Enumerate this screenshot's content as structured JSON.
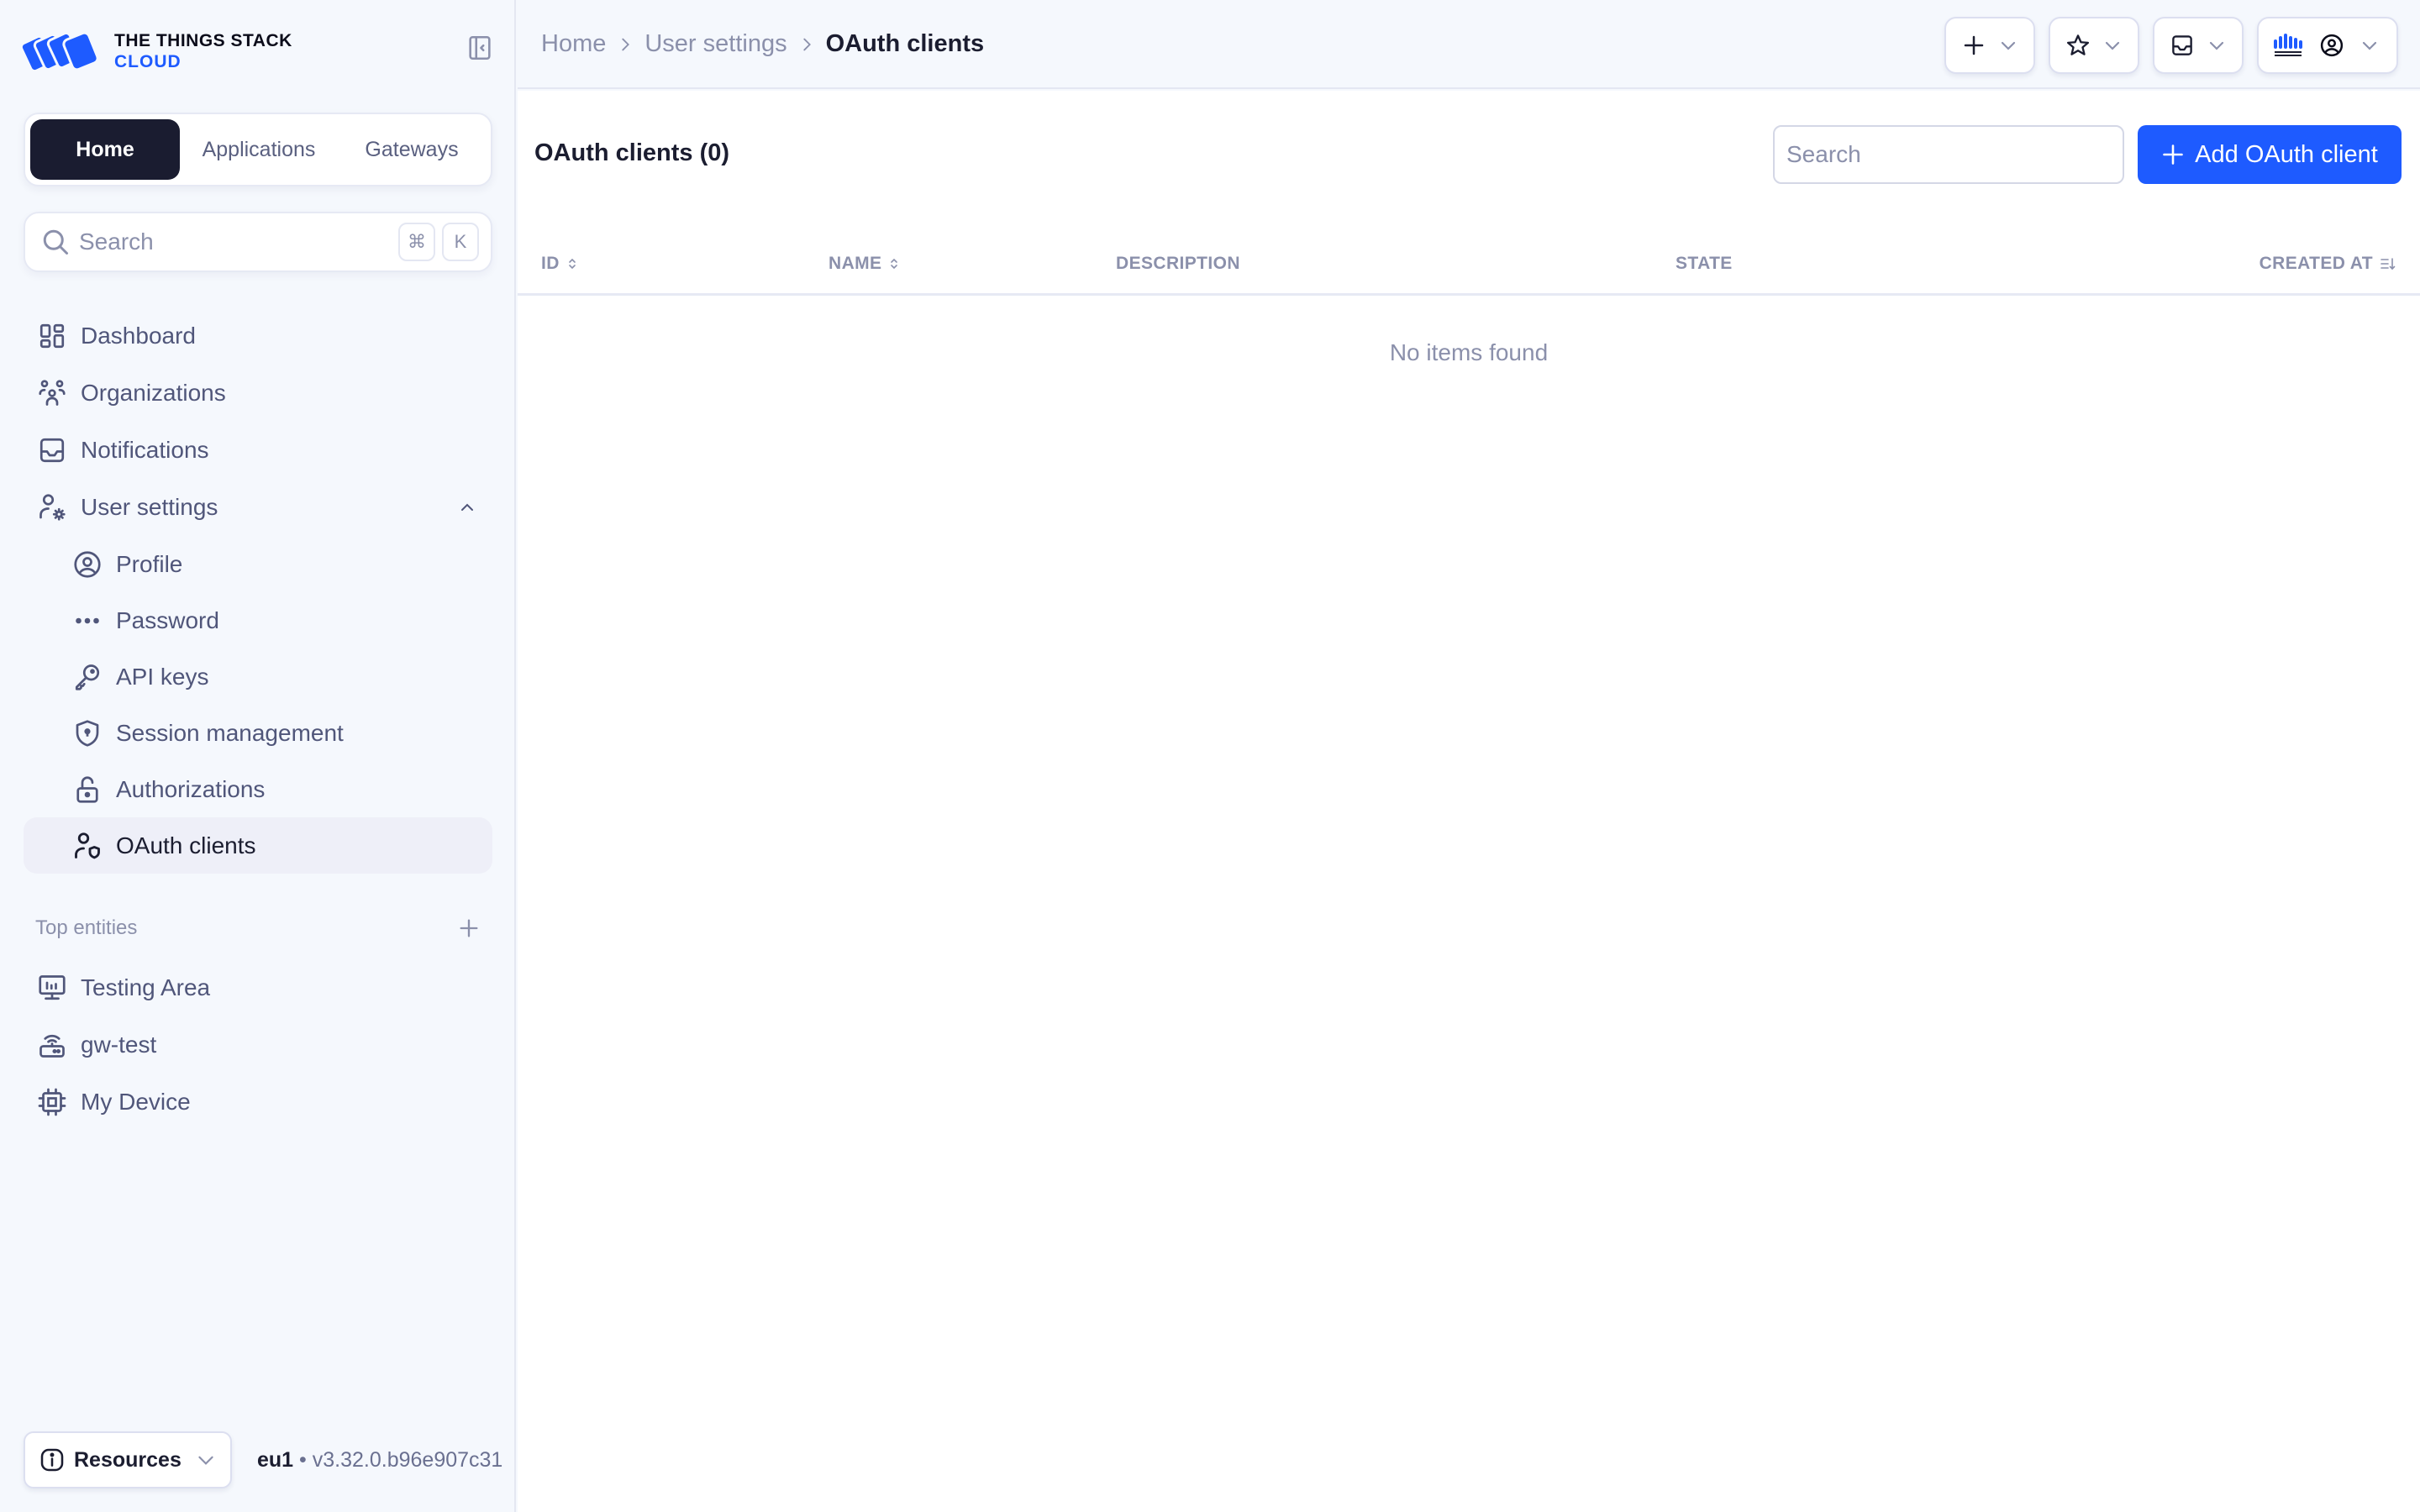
{
  "brand": {
    "line1": "THE THINGS STACK",
    "line2": "CLOUD",
    "accent_color": "#1e5bff",
    "logo_icon": "stacked-cards-logo"
  },
  "sidebar": {
    "collapse_icon": "sidebar-collapse-icon",
    "switcher": [
      {
        "label": "Home",
        "active": true
      },
      {
        "label": "Applications",
        "active": false
      },
      {
        "label": "Gateways",
        "active": false
      }
    ],
    "search": {
      "placeholder": "Search",
      "shortcut_mod": "⌘",
      "shortcut_key": "K"
    },
    "nav": [
      {
        "label": "Dashboard",
        "icon": "dashboard-icon"
      },
      {
        "label": "Organizations",
        "icon": "organizations-icon"
      },
      {
        "label": "Notifications",
        "icon": "inbox-icon"
      },
      {
        "label": "User settings",
        "icon": "user-settings-icon",
        "expanded": true,
        "children": [
          {
            "label": "Profile",
            "icon": "profile-icon"
          },
          {
            "label": "Password",
            "icon": "password-icon"
          },
          {
            "label": "API keys",
            "icon": "key-icon"
          },
          {
            "label": "Session management",
            "icon": "shield-lock-icon"
          },
          {
            "label": "Authorizations",
            "icon": "unlock-icon"
          },
          {
            "label": "OAuth clients",
            "icon": "user-shield-icon",
            "active": true
          }
        ]
      }
    ],
    "top_entities": {
      "title": "Top entities",
      "items": [
        {
          "label": "Testing Area",
          "icon": "application-icon"
        },
        {
          "label": "gw-test",
          "icon": "gateway-icon"
        },
        {
          "label": "My Device",
          "icon": "device-chip-icon"
        }
      ]
    },
    "footer": {
      "resources_label": "Resources",
      "cluster": "eu1",
      "separator": " • ",
      "version": "v3.32.0.b96e907c31"
    }
  },
  "header": {
    "breadcrumb": [
      {
        "label": "Home"
      },
      {
        "label": "User settings"
      },
      {
        "label": "OAuth clients",
        "current": true
      }
    ],
    "actions": [
      {
        "name": "add-menu",
        "icon": "plus-icon"
      },
      {
        "name": "bookmarks-menu",
        "icon": "star-icon"
      },
      {
        "name": "notifications-menu",
        "icon": "inbox-icon"
      },
      {
        "name": "account-menu",
        "icon": "user-circle-icon",
        "org_logo": "the-things-industries-logo"
      }
    ]
  },
  "main": {
    "title": "OAuth clients (0)",
    "search_placeholder": "Search",
    "add_button_label": "Add OAuth client",
    "table": {
      "columns": [
        {
          "label": "ID",
          "sortable": true
        },
        {
          "label": "NAME",
          "sortable": true
        },
        {
          "label": "DESCRIPTION",
          "sortable": false
        },
        {
          "label": "STATE",
          "sortable": false
        },
        {
          "label": "CREATED AT",
          "sortable": true,
          "sorted": "desc"
        }
      ],
      "rows": [],
      "empty_message": "No items found"
    }
  }
}
